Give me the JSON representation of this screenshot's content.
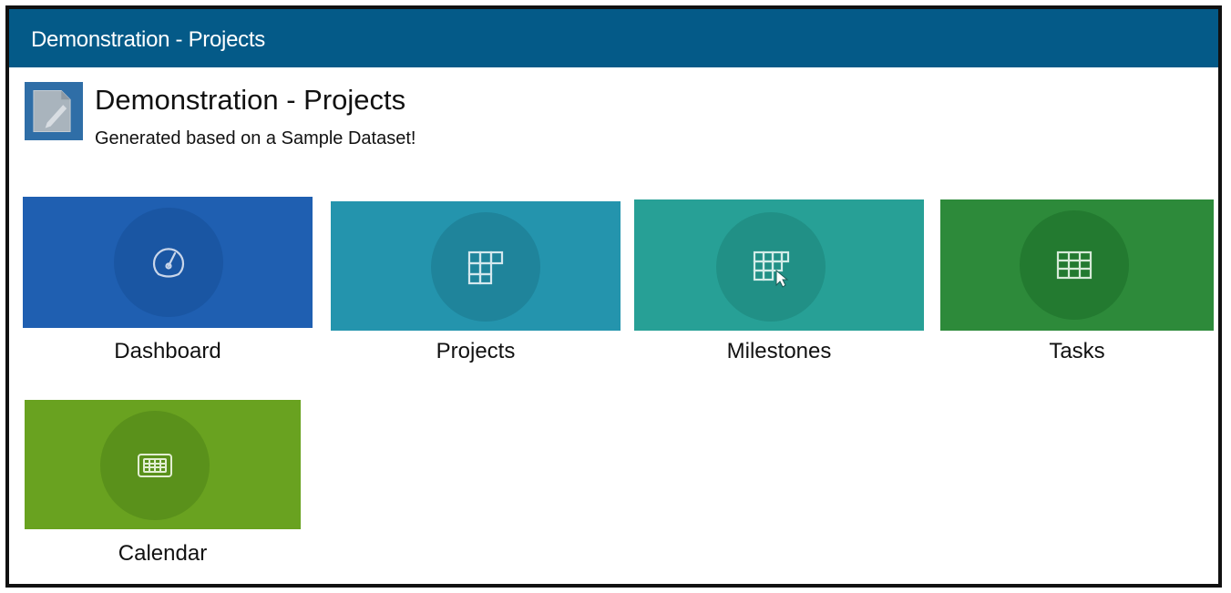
{
  "window": {
    "title": "Demonstration - Projects"
  },
  "header": {
    "app_icon": "document-edit-icon",
    "title": "Demonstration - Projects",
    "subtitle": "Generated based on a Sample Dataset!"
  },
  "tiles": [
    {
      "label": "Dashboard",
      "icon": "speedometer-icon",
      "bg": "#1f5fb1",
      "circle": "#1a56a3"
    },
    {
      "label": "Projects",
      "icon": "grid-icon",
      "bg": "#2494ad",
      "circle": "#1f849b"
    },
    {
      "label": "Milestones",
      "icon": "grid-cursor-icon",
      "bg": "#27a096",
      "circle": "#219086"
    },
    {
      "label": "Tasks",
      "icon": "table-icon",
      "bg": "#2d8a3a",
      "circle": "#237a30"
    },
    {
      "label": "Calendar",
      "icon": "calendar-icon",
      "bg": "#69a220",
      "circle": "#5a911b"
    }
  ],
  "colors": {
    "titlebar": "#045a88",
    "app_icon_bg": "#2f6ea7"
  }
}
